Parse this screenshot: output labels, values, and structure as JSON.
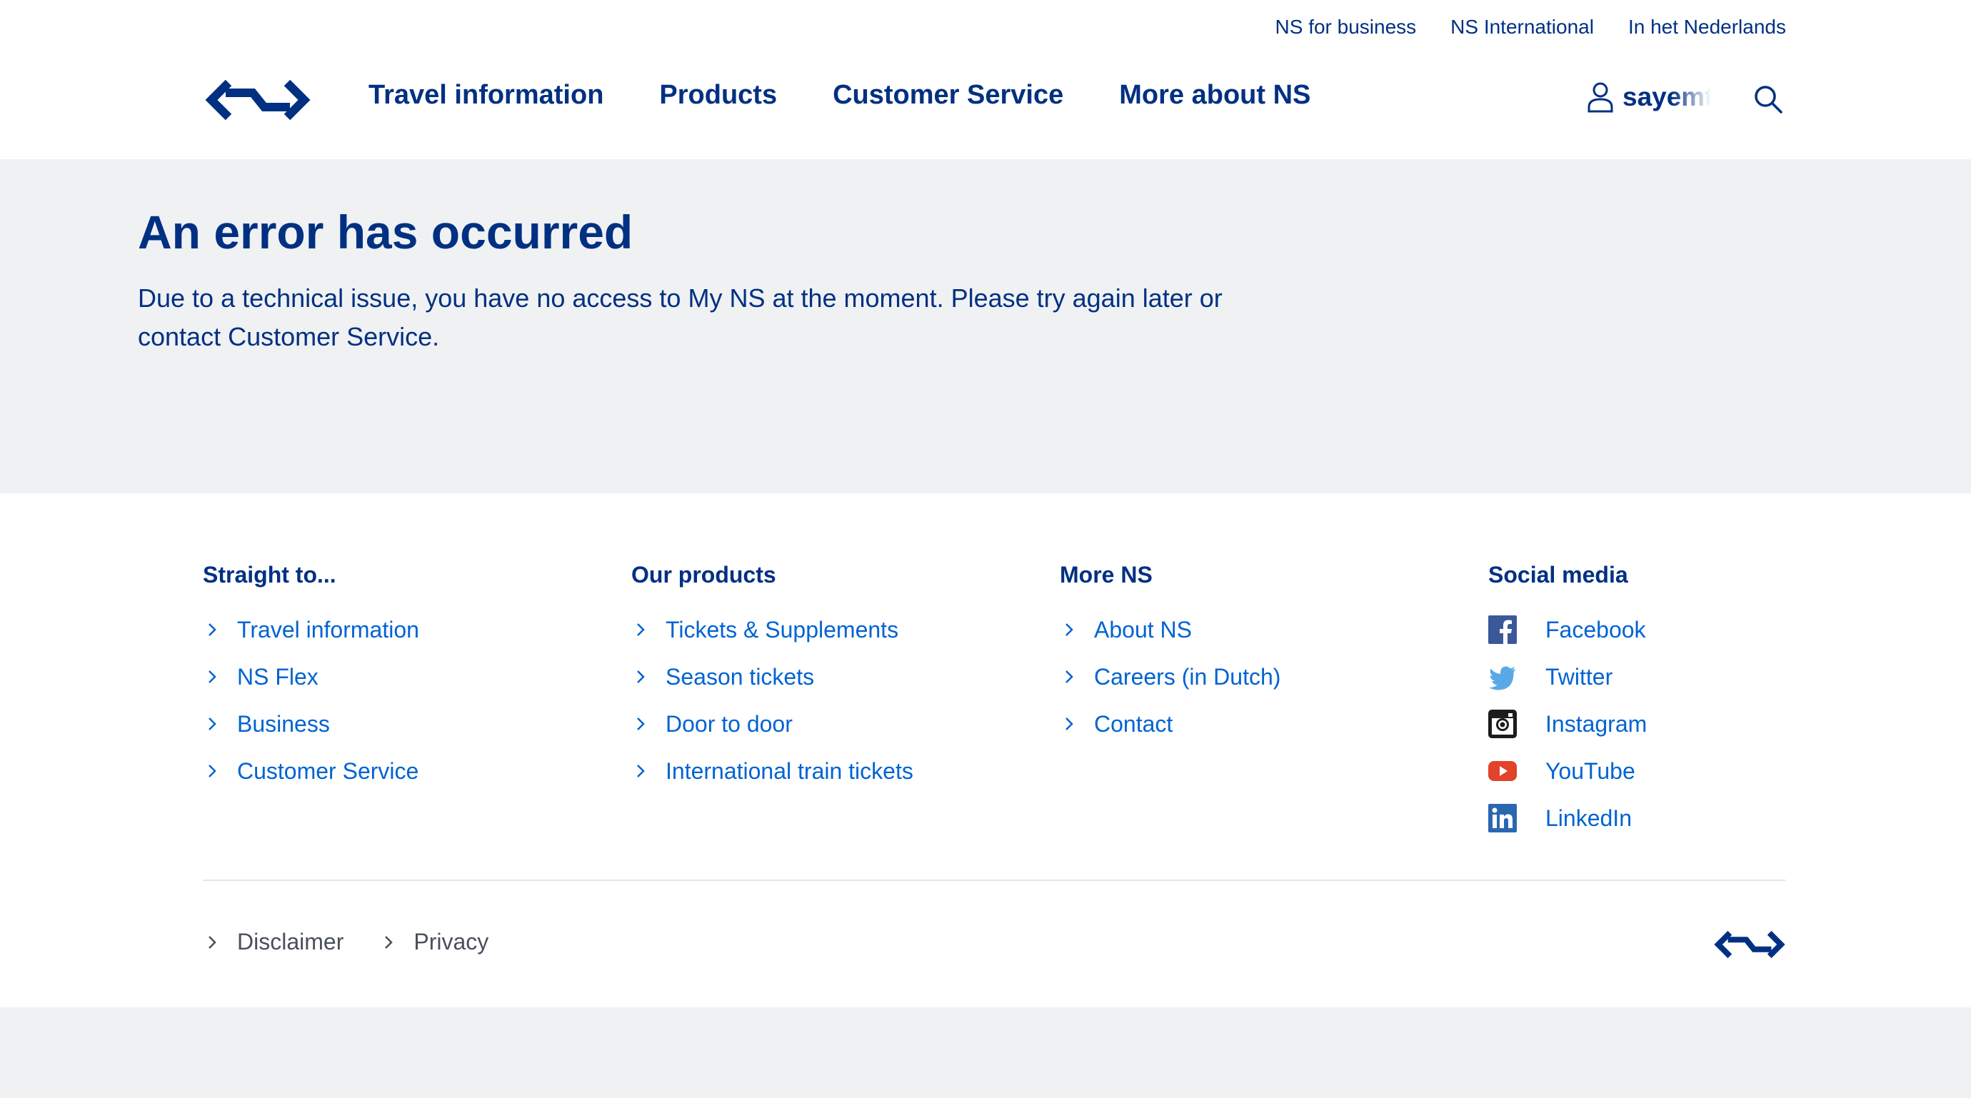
{
  "header": {
    "util_links": [
      "NS for business",
      "NS International",
      "In het Nederlands"
    ],
    "main_nav": [
      "Travel information",
      "Products",
      "Customer Service",
      "More about NS"
    ],
    "user_name": "sayemt"
  },
  "error": {
    "title": "An error has occurred",
    "message": "Due to a technical issue, you have no access to My NS at the moment. Please try again later or contact Customer Service."
  },
  "footer": {
    "columns": [
      {
        "title": "Straight to...",
        "items": [
          "Travel information",
          "NS Flex",
          "Business",
          "Customer Service"
        ]
      },
      {
        "title": "Our products",
        "items": [
          "Tickets & Supplements",
          "Season tickets",
          "Door to door",
          "International train tickets"
        ]
      },
      {
        "title": "More NS",
        "items": [
          "About NS",
          "Careers (in Dutch)",
          "Contact"
        ]
      }
    ],
    "social": {
      "title": "Social media",
      "items": [
        {
          "label": "Facebook",
          "icon": "facebook-icon"
        },
        {
          "label": "Twitter",
          "icon": "twitter-icon"
        },
        {
          "label": "Instagram",
          "icon": "instagram-icon"
        },
        {
          "label": "YouTube",
          "icon": "youtube-icon"
        },
        {
          "label": "LinkedIn",
          "icon": "linkedin-icon"
        }
      ]
    },
    "legal": [
      "Disclaimer",
      "Privacy"
    ]
  },
  "colors": {
    "brand_blue": "#003082",
    "link_blue": "#0063d3",
    "background": "#f0f1f3"
  }
}
